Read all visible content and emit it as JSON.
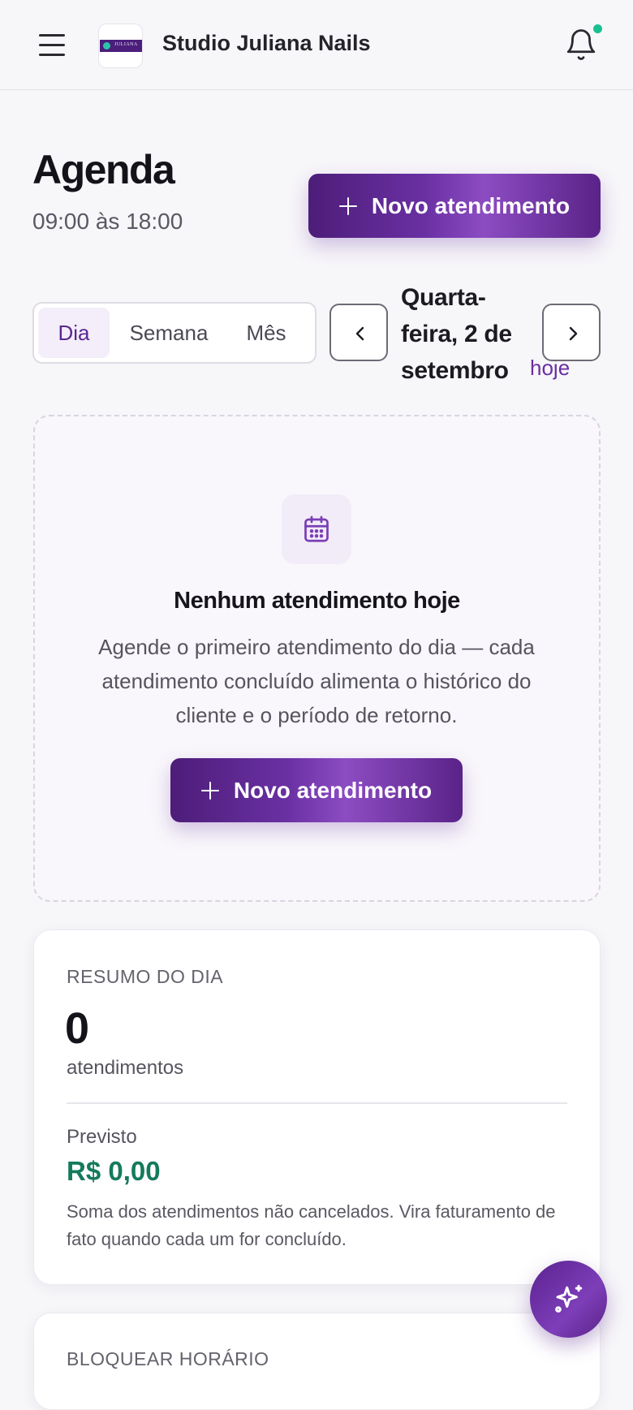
{
  "header": {
    "studio_name": "Studio Juliana Nails",
    "logo_text": "JULIANA",
    "has_notification": true,
    "notification_color": "#19c08f"
  },
  "page": {
    "title": "Agenda",
    "hours": "09:00 às 18:00",
    "new_button_label": "Novo atendimento"
  },
  "view_switcher": {
    "options": [
      "Dia",
      "Semana",
      "Mês"
    ],
    "selected": "Dia"
  },
  "date_nav": {
    "date_label_lines": [
      "Quarta-",
      "feira, 2 de",
      "setembro"
    ],
    "today_label": "hoje"
  },
  "empty_state": {
    "icon": "calendar-icon",
    "title": "Nenhum atendimento hoje",
    "description": "Agende o primeiro atendimento do dia — cada atendimento concluído alimenta o histórico do cliente e o período de retorno.",
    "button_label": "Novo atendimento"
  },
  "summary": {
    "label": "RESUMO DO DIA",
    "count": "0",
    "count_unit": "atendimentos",
    "forecast_label": "Previsto",
    "forecast_value": "R$ 0,00",
    "forecast_note": "Soma dos atendimentos não cancelados. Vira faturamento de fato quando cada um for concluído."
  },
  "block_time": {
    "label": "BLOQUEAR HORÁRIO"
  },
  "fab": {
    "icon": "sparkles-icon"
  },
  "colors": {
    "accent": "#5b2890",
    "money": "#157a5c"
  }
}
